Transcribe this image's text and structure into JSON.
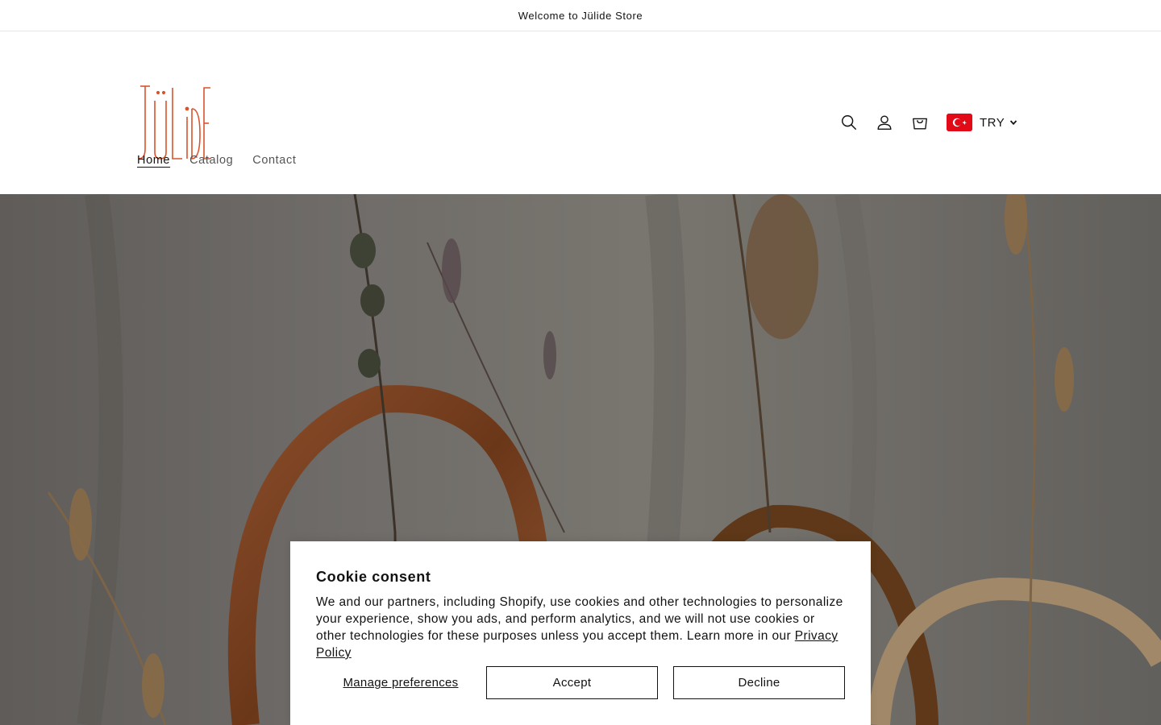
{
  "announcement": {
    "text": "Welcome to Jülide Store"
  },
  "header": {
    "logo_text": "JÜLiDE",
    "logo_color": "#d9542b",
    "icons": [
      "search-icon",
      "account-icon",
      "cart-icon"
    ],
    "currency": {
      "code": "TRY",
      "flag": "turkey-flag-icon"
    }
  },
  "nav": {
    "items": [
      {
        "label": "Home",
        "active": true
      },
      {
        "label": "Catalog",
        "active": false
      },
      {
        "label": "Contact",
        "active": false
      }
    ]
  },
  "cookie": {
    "title": "Cookie consent",
    "text": "We and our partners, including Shopify, use cookies and other technologies to personalize your experience, show you ads, and perform analytics, and we will not use cookies or other technologies for these purposes unless you accept them. Learn more in our",
    "link_label": "Privacy Policy",
    "manage_label": "Manage preferences",
    "accept_label": "Accept",
    "decline_label": "Decline"
  }
}
